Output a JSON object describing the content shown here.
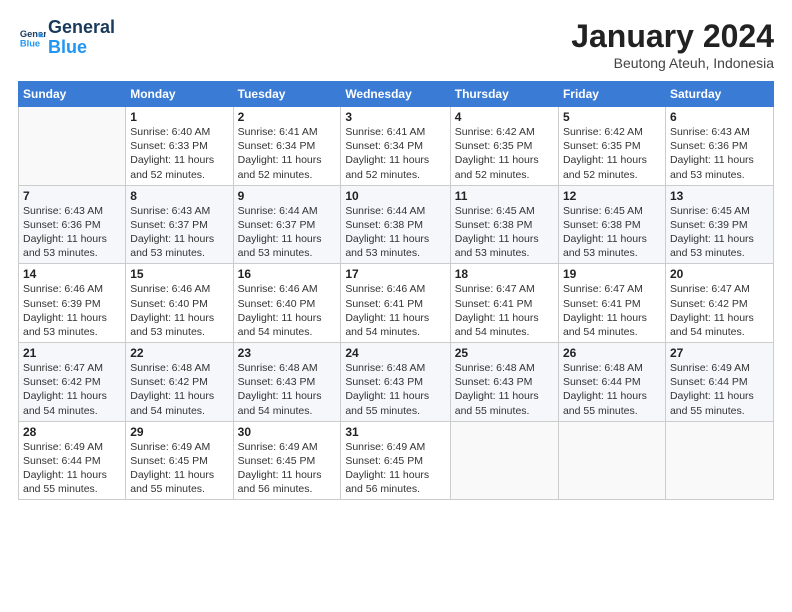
{
  "header": {
    "logo_line1": "General",
    "logo_line2": "Blue",
    "month": "January 2024",
    "location": "Beutong Ateuh, Indonesia"
  },
  "days_of_week": [
    "Sunday",
    "Monday",
    "Tuesday",
    "Wednesday",
    "Thursday",
    "Friday",
    "Saturday"
  ],
  "weeks": [
    [
      {
        "num": "",
        "info": ""
      },
      {
        "num": "1",
        "info": "Sunrise: 6:40 AM\nSunset: 6:33 PM\nDaylight: 11 hours\nand 52 minutes."
      },
      {
        "num": "2",
        "info": "Sunrise: 6:41 AM\nSunset: 6:34 PM\nDaylight: 11 hours\nand 52 minutes."
      },
      {
        "num": "3",
        "info": "Sunrise: 6:41 AM\nSunset: 6:34 PM\nDaylight: 11 hours\nand 52 minutes."
      },
      {
        "num": "4",
        "info": "Sunrise: 6:42 AM\nSunset: 6:35 PM\nDaylight: 11 hours\nand 52 minutes."
      },
      {
        "num": "5",
        "info": "Sunrise: 6:42 AM\nSunset: 6:35 PM\nDaylight: 11 hours\nand 52 minutes."
      },
      {
        "num": "6",
        "info": "Sunrise: 6:43 AM\nSunset: 6:36 PM\nDaylight: 11 hours\nand 53 minutes."
      }
    ],
    [
      {
        "num": "7",
        "info": "Sunrise: 6:43 AM\nSunset: 6:36 PM\nDaylight: 11 hours\nand 53 minutes."
      },
      {
        "num": "8",
        "info": "Sunrise: 6:43 AM\nSunset: 6:37 PM\nDaylight: 11 hours\nand 53 minutes."
      },
      {
        "num": "9",
        "info": "Sunrise: 6:44 AM\nSunset: 6:37 PM\nDaylight: 11 hours\nand 53 minutes."
      },
      {
        "num": "10",
        "info": "Sunrise: 6:44 AM\nSunset: 6:38 PM\nDaylight: 11 hours\nand 53 minutes."
      },
      {
        "num": "11",
        "info": "Sunrise: 6:45 AM\nSunset: 6:38 PM\nDaylight: 11 hours\nand 53 minutes."
      },
      {
        "num": "12",
        "info": "Sunrise: 6:45 AM\nSunset: 6:38 PM\nDaylight: 11 hours\nand 53 minutes."
      },
      {
        "num": "13",
        "info": "Sunrise: 6:45 AM\nSunset: 6:39 PM\nDaylight: 11 hours\nand 53 minutes."
      }
    ],
    [
      {
        "num": "14",
        "info": "Sunrise: 6:46 AM\nSunset: 6:39 PM\nDaylight: 11 hours\nand 53 minutes."
      },
      {
        "num": "15",
        "info": "Sunrise: 6:46 AM\nSunset: 6:40 PM\nDaylight: 11 hours\nand 53 minutes."
      },
      {
        "num": "16",
        "info": "Sunrise: 6:46 AM\nSunset: 6:40 PM\nDaylight: 11 hours\nand 54 minutes."
      },
      {
        "num": "17",
        "info": "Sunrise: 6:46 AM\nSunset: 6:41 PM\nDaylight: 11 hours\nand 54 minutes."
      },
      {
        "num": "18",
        "info": "Sunrise: 6:47 AM\nSunset: 6:41 PM\nDaylight: 11 hours\nand 54 minutes."
      },
      {
        "num": "19",
        "info": "Sunrise: 6:47 AM\nSunset: 6:41 PM\nDaylight: 11 hours\nand 54 minutes."
      },
      {
        "num": "20",
        "info": "Sunrise: 6:47 AM\nSunset: 6:42 PM\nDaylight: 11 hours\nand 54 minutes."
      }
    ],
    [
      {
        "num": "21",
        "info": "Sunrise: 6:47 AM\nSunset: 6:42 PM\nDaylight: 11 hours\nand 54 minutes."
      },
      {
        "num": "22",
        "info": "Sunrise: 6:48 AM\nSunset: 6:42 PM\nDaylight: 11 hours\nand 54 minutes."
      },
      {
        "num": "23",
        "info": "Sunrise: 6:48 AM\nSunset: 6:43 PM\nDaylight: 11 hours\nand 54 minutes."
      },
      {
        "num": "24",
        "info": "Sunrise: 6:48 AM\nSunset: 6:43 PM\nDaylight: 11 hours\nand 55 minutes."
      },
      {
        "num": "25",
        "info": "Sunrise: 6:48 AM\nSunset: 6:43 PM\nDaylight: 11 hours\nand 55 minutes."
      },
      {
        "num": "26",
        "info": "Sunrise: 6:48 AM\nSunset: 6:44 PM\nDaylight: 11 hours\nand 55 minutes."
      },
      {
        "num": "27",
        "info": "Sunrise: 6:49 AM\nSunset: 6:44 PM\nDaylight: 11 hours\nand 55 minutes."
      }
    ],
    [
      {
        "num": "28",
        "info": "Sunrise: 6:49 AM\nSunset: 6:44 PM\nDaylight: 11 hours\nand 55 minutes."
      },
      {
        "num": "29",
        "info": "Sunrise: 6:49 AM\nSunset: 6:45 PM\nDaylight: 11 hours\nand 55 minutes."
      },
      {
        "num": "30",
        "info": "Sunrise: 6:49 AM\nSunset: 6:45 PM\nDaylight: 11 hours\nand 56 minutes."
      },
      {
        "num": "31",
        "info": "Sunrise: 6:49 AM\nSunset: 6:45 PM\nDaylight: 11 hours\nand 56 minutes."
      },
      {
        "num": "",
        "info": ""
      },
      {
        "num": "",
        "info": ""
      },
      {
        "num": "",
        "info": ""
      }
    ]
  ]
}
